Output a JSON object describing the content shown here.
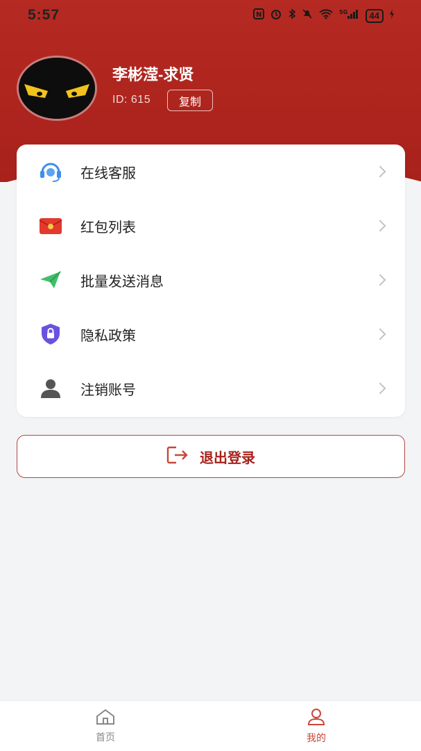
{
  "status_bar": {
    "time": "5:57",
    "battery": "44",
    "icons": [
      "nfc-icon",
      "alarm-icon",
      "bluetooth-icon",
      "mute-icon",
      "wifi-icon",
      "signal-5g-icon",
      "battery-icon",
      "charging-icon"
    ]
  },
  "profile": {
    "name": "李彬滢-求贤",
    "id_text": "ID:  615",
    "copy_label": "复制"
  },
  "menu": {
    "items": [
      {
        "label": "在线客服",
        "icon": "headset-icon",
        "color": "#3b8df0"
      },
      {
        "label": "红包列表",
        "icon": "red-envelope-icon",
        "color": "#e23a2c"
      },
      {
        "label": "批量发送消息",
        "icon": "paper-plane-icon",
        "color": "#3fbf6a"
      },
      {
        "label": "隐私政策",
        "icon": "shield-lock-icon",
        "color": "#6a52e0"
      },
      {
        "label": "注销账号",
        "icon": "user-icon",
        "color": "#555555"
      }
    ]
  },
  "logout": {
    "label": "退出登录",
    "icon": "logout-icon"
  },
  "tabbar": {
    "tabs": [
      {
        "label": "首页",
        "icon": "home-icon",
        "active": false
      },
      {
        "label": "我的",
        "icon": "profile-icon",
        "active": true
      }
    ],
    "active_color": "#c8463a",
    "inactive_color": "#888888"
  },
  "colors": {
    "header": "#b52a22",
    "accent": "#a8211b"
  }
}
